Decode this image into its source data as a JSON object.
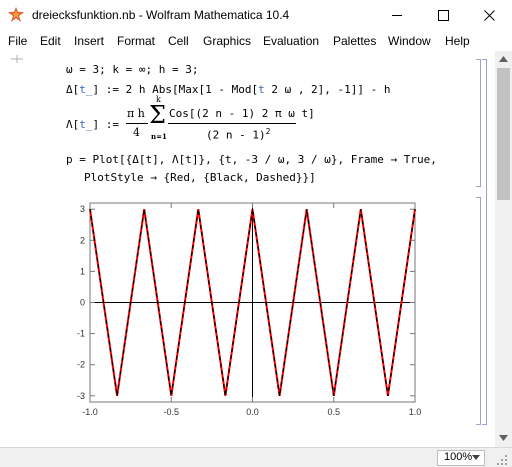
{
  "window": {
    "title": "dreiecksfunktion.nb - Wolfram Mathematica 10.4",
    "icons": [
      "mathematica-icon",
      "minimize-icon",
      "maximize-icon",
      "close-icon"
    ]
  },
  "menu": [
    "File",
    "Edit",
    "Insert",
    "Format",
    "Cell",
    "Graphics",
    "Evaluation",
    "Palettes",
    "Window",
    "Help"
  ],
  "notebook": {
    "line1": "ω = 3;  k = ∞;  h = 3;",
    "line2_head": "Δ[",
    "line2_var": "t_",
    "line2_rest": "] := 2 h Abs[Max[1 - Mod[",
    "line2_var2": "t",
    "line2_tail": " 2 ω , 2], -1]] - h",
    "line3": {
      "lhs_head": "Λ[",
      "lhs_var": "t_",
      "lhs_tail": "] :=",
      "coef_num": "π h",
      "coef_den": "4",
      "sum_upper": "k",
      "sum_sym": "Σ",
      "sum_lower": "n=1",
      "frac_num": "Cos[(2 n - 1) 2 π ω t]",
      "frac_den": "(2 n - 1)",
      "frac_den_exp": "2"
    },
    "line4": "p = Plot[{Δ[t], Λ[t]}, {t, -3 / ω, 3 / ω}, Frame → True,",
    "line5": "PlotStyle → {Red, {Black, Dashed}}]"
  },
  "chart_data": {
    "type": "line",
    "title": "",
    "xlabel": "",
    "ylabel": "",
    "xlim": [
      -1.0,
      1.0
    ],
    "ylim": [
      -3.2,
      3.2
    ],
    "x_ticks": [
      "-1.0",
      "-0.5",
      "0.0",
      "0.5",
      "1.0"
    ],
    "y_ticks": [
      "3",
      "2",
      "1",
      "0",
      "-1",
      "-2",
      "-3"
    ],
    "x_tick_values": [
      -1.0,
      -0.5,
      0.0,
      0.5,
      1.0
    ],
    "y_tick_values": [
      3,
      2,
      1,
      0,
      -1,
      -2,
      -3
    ],
    "grid": false,
    "series": [
      {
        "color": "#ff0000",
        "style": "solid",
        "x": [
          -1.0,
          -0.8333,
          -0.6667,
          -0.5,
          -0.3333,
          -0.1667,
          0.0,
          0.1667,
          0.3333,
          0.5,
          0.6667,
          0.8333,
          1.0
        ],
        "y": [
          3,
          -3,
          3,
          -3,
          3,
          -3,
          3,
          -3,
          3,
          -3,
          3,
          -3,
          3
        ]
      },
      {
        "color": "#000000",
        "style": "dashed",
        "x": [
          -1.0,
          -0.8333,
          -0.6667,
          -0.5,
          -0.3333,
          -0.1667,
          0.0,
          0.1667,
          0.3333,
          0.5,
          0.6667,
          0.8333,
          1.0
        ],
        "y": [
          3,
          -3,
          3,
          -3,
          3,
          -3,
          3,
          -3,
          3,
          -3,
          3,
          -3,
          3
        ]
      }
    ]
  },
  "status": {
    "zoom": "100%"
  }
}
